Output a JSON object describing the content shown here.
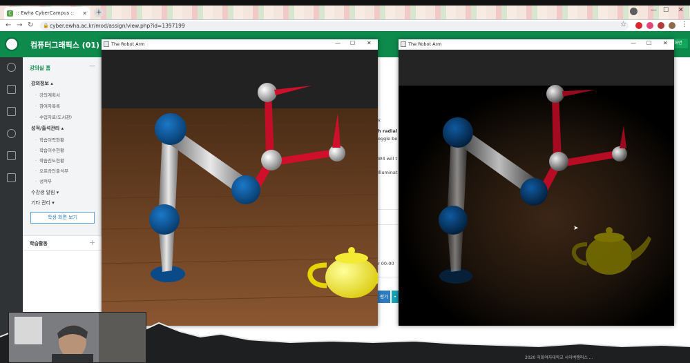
{
  "browser": {
    "tab_title": ":: Ewha CyberCampus ::",
    "url": "cyber.ewha.ac.kr/mod/assign/view.php?id=1397199",
    "new_tab_symbol": "+",
    "close_symbol": "✕"
  },
  "header": {
    "course_title": "컴퓨터그래픽스 (01)",
    "right_button": "화면"
  },
  "sidebar": {
    "home": "강의실 홈",
    "collapse_symbol": "—",
    "section_info": "강의정보 ▴",
    "info_items": [
      "강의계획서",
      "참여자목록",
      "수업자료(도서관)"
    ],
    "section_grades": "성적/출석관리 ▴",
    "grade_items": [
      "학습이력현황",
      "학습이수현황",
      "학습진도현황",
      "오프라인출석부",
      "성적부"
    ],
    "sub_alerts": "수강생 알림 ▾",
    "sub_other": "기타 관리 ▾",
    "student_view_button": "학생 화면 보기",
    "activity": "학습활동",
    "activity_expand": "+"
  },
  "page_peek": {
    "texts": [
      "s:",
      "h radial a",
      "oggle be",
      "W4 will t",
      "Illuminat",
      "r 00:00"
    ],
    "button_1": "평가",
    "button_2": "•"
  },
  "windows": [
    {
      "title": "The Robot Arm",
      "minimize": "—",
      "maximize": "☐",
      "close": "✕"
    },
    {
      "title": "The Robot Arm",
      "minimize": "—",
      "maximize": "☐",
      "close": "✕"
    }
  ],
  "footer": "2020 이화여자대학교 사이버캠퍼스 ...",
  "colors": {
    "header_green": "#0d8a4c",
    "joint_blue": "#0b5aa0",
    "link_red": "#d0102a",
    "teapot_yellow": "#f2e400",
    "floor_wood": "#7a4a26"
  }
}
